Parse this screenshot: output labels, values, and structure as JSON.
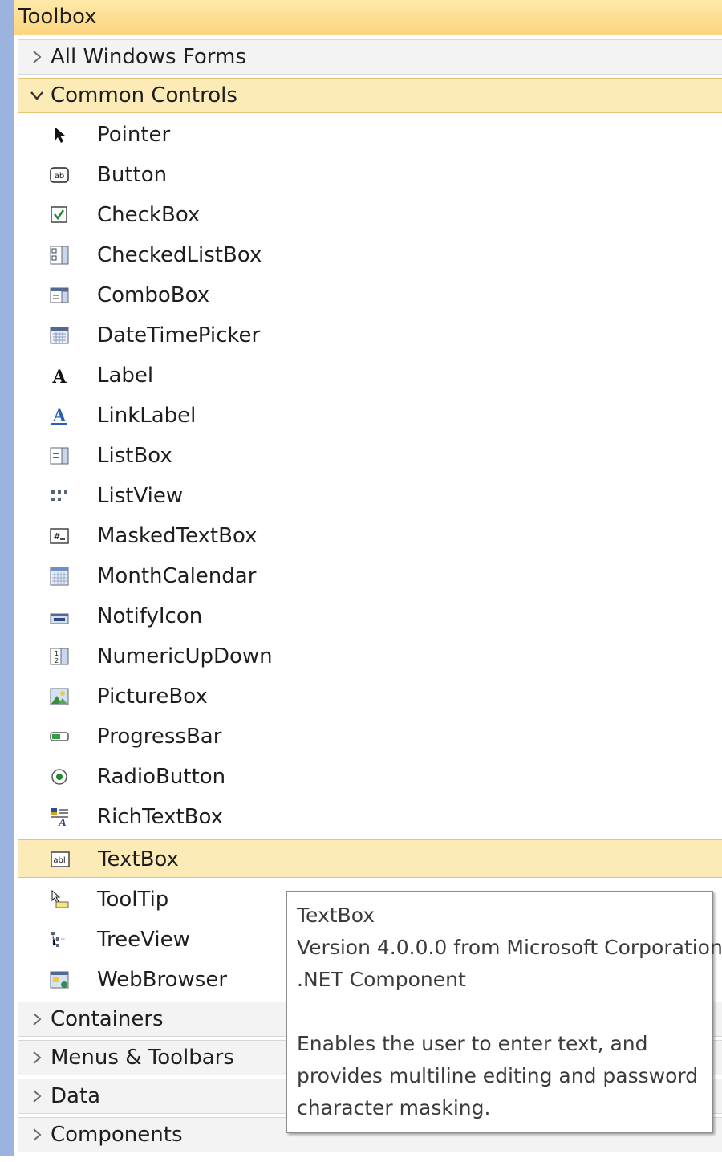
{
  "toolbox": {
    "title": "Toolbox",
    "groups_top": [
      {
        "label": "All Windows Forms",
        "expanded": false
      },
      {
        "label": "Common Controls",
        "expanded": true
      }
    ],
    "items": [
      {
        "label": "Pointer",
        "icon": "pointer-icon"
      },
      {
        "label": "Button",
        "icon": "button-icon"
      },
      {
        "label": "CheckBox",
        "icon": "checkbox-icon"
      },
      {
        "label": "CheckedListBox",
        "icon": "checkedlistbox-icon"
      },
      {
        "label": "ComboBox",
        "icon": "combobox-icon"
      },
      {
        "label": "DateTimePicker",
        "icon": "datetimepicker-icon"
      },
      {
        "label": "Label",
        "icon": "label-icon"
      },
      {
        "label": "LinkLabel",
        "icon": "linklabel-icon"
      },
      {
        "label": "ListBox",
        "icon": "listbox-icon"
      },
      {
        "label": "ListView",
        "icon": "listview-icon"
      },
      {
        "label": "MaskedTextBox",
        "icon": "maskedtextbox-icon"
      },
      {
        "label": "MonthCalendar",
        "icon": "monthcalendar-icon"
      },
      {
        "label": "NotifyIcon",
        "icon": "notifyicon-icon"
      },
      {
        "label": "NumericUpDown",
        "icon": "numericupdown-icon"
      },
      {
        "label": "PictureBox",
        "icon": "picturebox-icon"
      },
      {
        "label": "ProgressBar",
        "icon": "progressbar-icon"
      },
      {
        "label": "RadioButton",
        "icon": "radiobutton-icon"
      },
      {
        "label": "RichTextBox",
        "icon": "richtextbox-icon"
      },
      {
        "label": "TextBox",
        "icon": "textbox-icon",
        "selected": true
      },
      {
        "label": "ToolTip",
        "icon": "tooltip-icon"
      },
      {
        "label": "TreeView",
        "icon": "treeview-icon"
      },
      {
        "label": "WebBrowser",
        "icon": "webbrowser-icon"
      }
    ],
    "groups_bottom": [
      {
        "label": "Containers",
        "expanded": false
      },
      {
        "label": "Menus & Toolbars",
        "expanded": false
      },
      {
        "label": "Data",
        "expanded": false
      },
      {
        "label": "Components",
        "expanded": false
      }
    ]
  },
  "tooltip": {
    "title": "TextBox",
    "version": "Version 4.0.0.0 from Microsoft Corporation",
    "kind": ".NET Component",
    "description_line1": "Enables the user to enter text, and",
    "description_line2": "provides multiline editing and password",
    "description_line3": "character masking."
  },
  "colors": {
    "selected_bg": "#fcebb7",
    "title_bg": "#fbd57f",
    "left_strip": "#9db3df"
  }
}
